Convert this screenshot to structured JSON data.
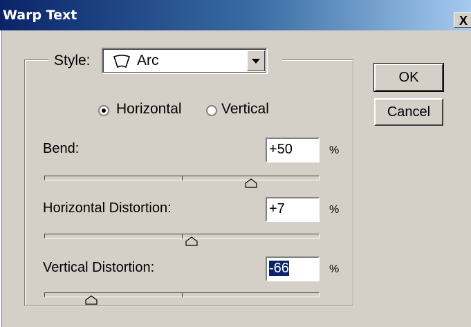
{
  "window": {
    "title": "Warp Text",
    "close_glyph": "X"
  },
  "style": {
    "label": "Style:",
    "value": "Arc",
    "icon": "arc-warp-icon"
  },
  "orientation": {
    "horizontal_label": "Horizontal",
    "vertical_label": "Vertical",
    "selected": "Horizontal"
  },
  "bend": {
    "label": "Bend:",
    "value": "+50",
    "unit": "%",
    "slider_value": 50
  },
  "horizontal_distortion": {
    "label": "Horizontal Distortion:",
    "value": "+7",
    "unit": "%",
    "slider_value": 7
  },
  "vertical_distortion": {
    "label": "Vertical Distortion:",
    "value": "-66",
    "unit": "%",
    "slider_value": -66
  },
  "buttons": {
    "ok": "OK",
    "cancel": "Cancel"
  }
}
